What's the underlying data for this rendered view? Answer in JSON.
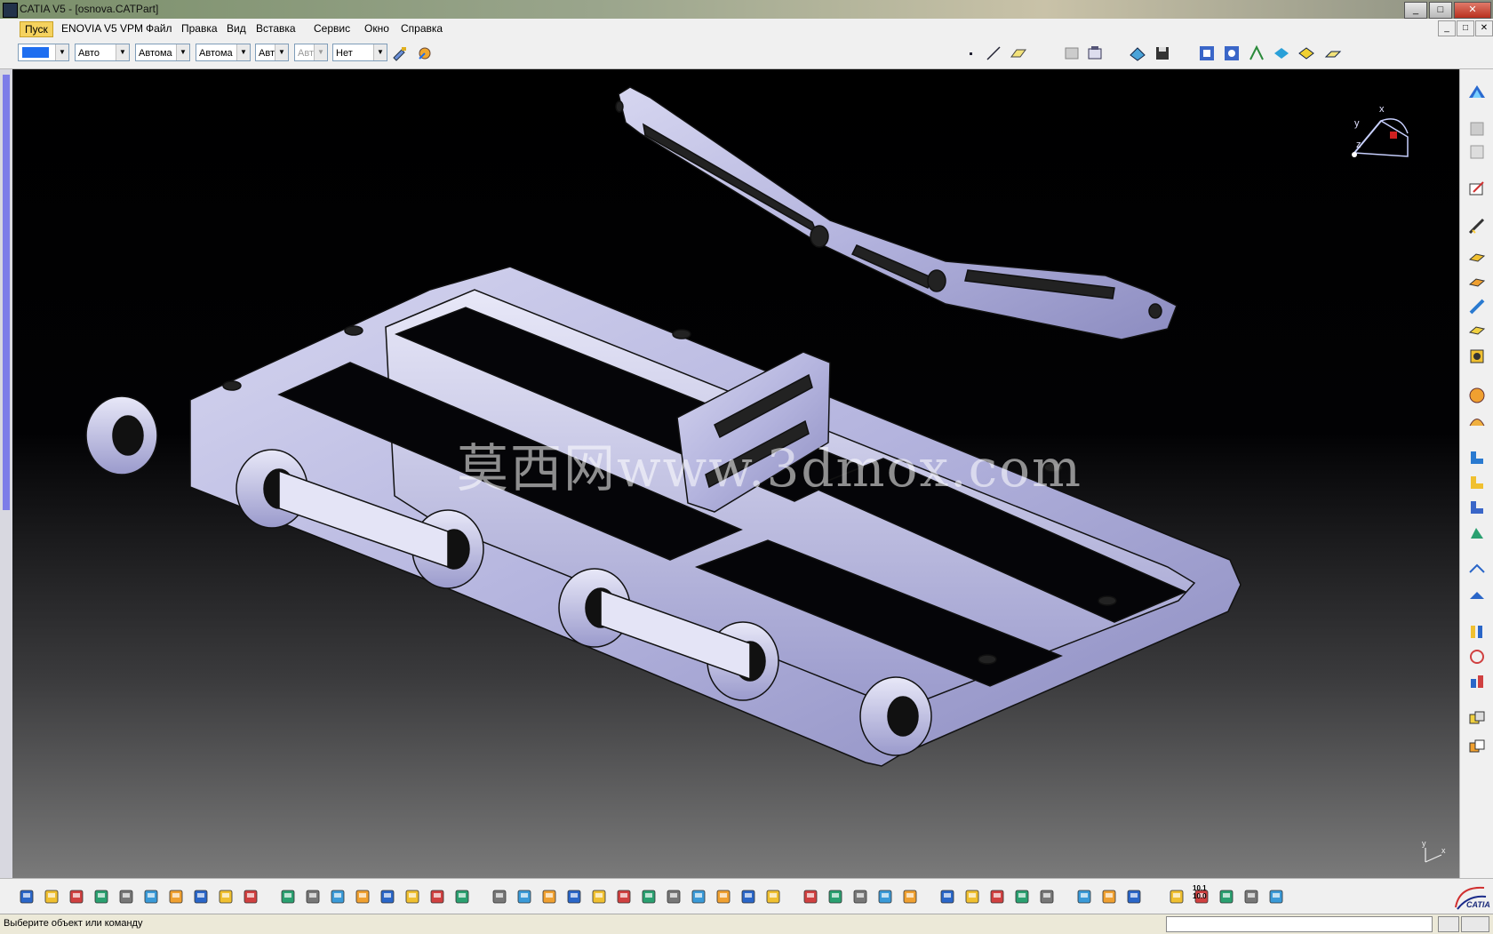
{
  "window": {
    "title": "CATIA V5 - [osnova.CATPart]",
    "controls": [
      "_",
      "□",
      "✕"
    ]
  },
  "menu": {
    "items": [
      "Пуск",
      "ENOVIA V5 VPM",
      "Файл",
      "Правка",
      "Вид",
      "Вставка",
      "Сервис",
      "Окно",
      "Справка"
    ]
  },
  "graphic_properties": {
    "color_hex": "#1e6ef0",
    "transparency": "Авто",
    "line_thickness": "Автома",
    "line_type": "Автома",
    "point_type": "Авт",
    "layer_disabled": "Авт",
    "layer": "Нет"
  },
  "viewport": {
    "watermark": "莫西网www.3dmox.com",
    "compass_labels": [
      "x",
      "y",
      "z"
    ],
    "axis_labels": [
      "y",
      "x"
    ]
  },
  "toolbars": {
    "bottom_icons": [
      "new-icon",
      "open-icon",
      "save-icon",
      "print-icon",
      "cut-icon",
      "copy-icon",
      "paste-icon",
      "undo-icon",
      "redo-icon",
      "whats-this-icon",
      "formula-icon",
      "comment-icon",
      "knowledge-icon",
      "table-icon",
      "tree-icon",
      "catalog-icon",
      "design-table-icon",
      "fly-icon",
      "fit-all-icon",
      "pan-icon",
      "rotate-icon",
      "zoom-in-icon",
      "zoom-out-icon",
      "normal-view-icon",
      "multi-view-icon",
      "iso-view-icon",
      "shading-icon",
      "hide-show-icon",
      "swap-icon",
      "dress-icon",
      "gear-icon",
      "gear2-icon",
      "robot-icon",
      "assembly-icon",
      "render-icon",
      "sketch-icon",
      "measure-icon",
      "inertia-icon",
      "cam-icon",
      "capture-icon",
      "swirl-icon",
      "hand-icon",
      "axis-icon",
      "scale-icon",
      "section-icon",
      "matrix-icon",
      "layer-icon",
      "material-icon"
    ],
    "bottom_labels": {
      "scale_top": "10.1",
      "scale_bottom": "10.0"
    }
  },
  "statusbar": {
    "message": "Выберите объект или команду",
    "command_input": ""
  },
  "brand": {
    "name": "CATIA"
  }
}
